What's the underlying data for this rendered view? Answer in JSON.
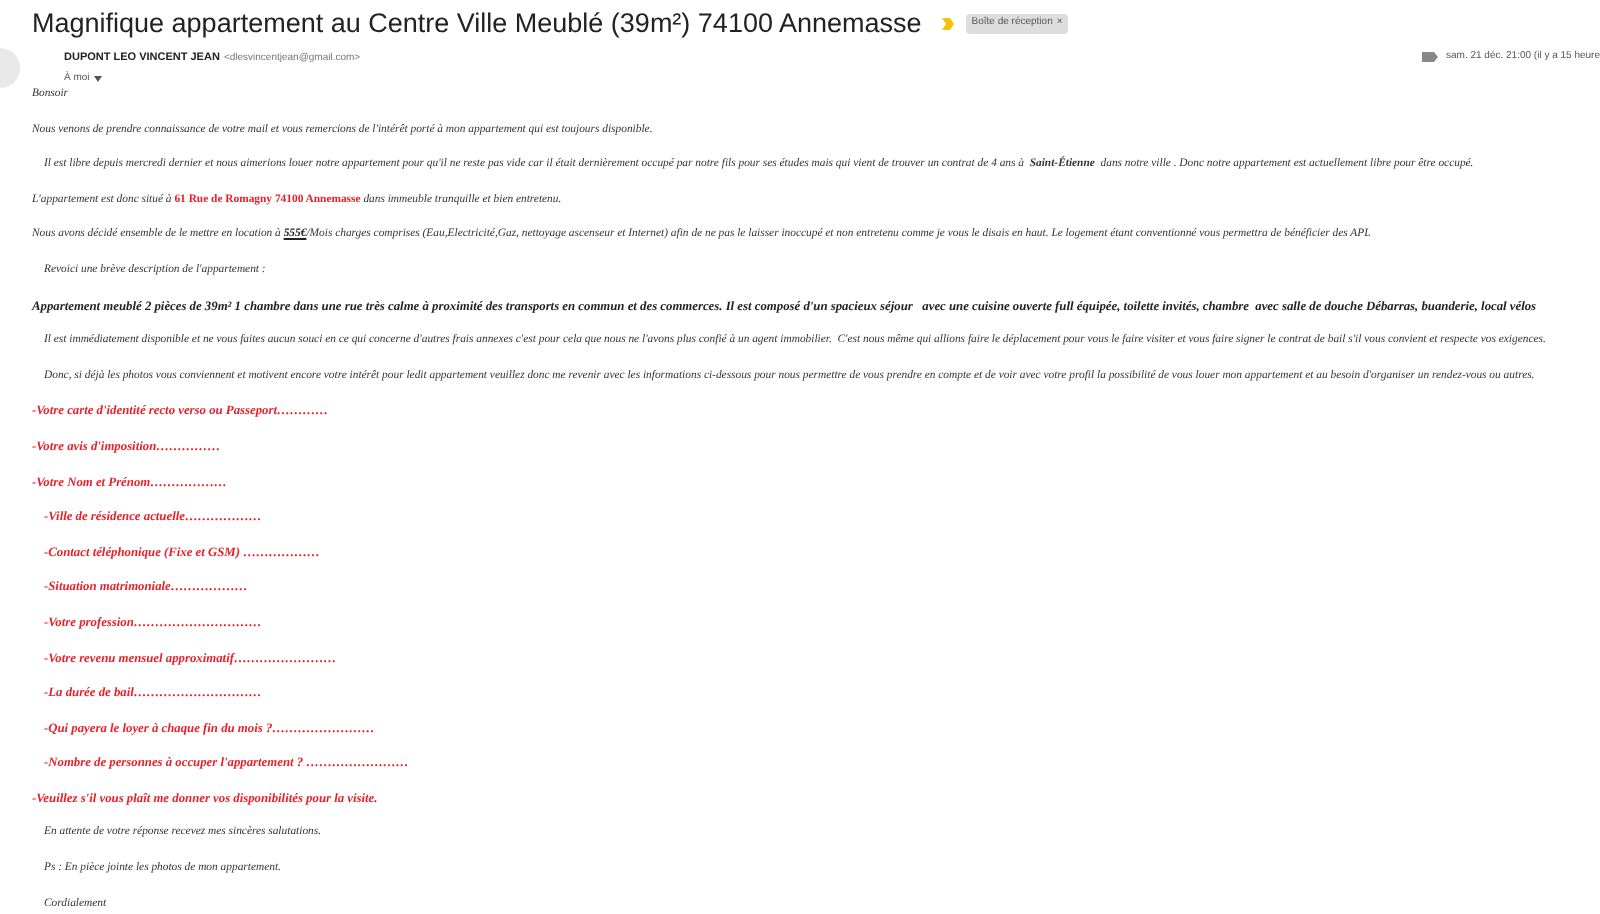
{
  "subject": "Magnifique appartement au Centre Ville Meublé (39m²) 74100 Annemasse",
  "important": true,
  "label": {
    "text": "Boîte de réception",
    "close": "×"
  },
  "sender": {
    "name": "DUPONT LEO VINCENT JEAN",
    "email": "<dlesvincentjean@gmail.com>",
    "to": "À moi"
  },
  "date": "sam. 21 déc. 21:00 (il y a 15 heure",
  "body": [
    {
      "kind": "text",
      "text": "Bonsoir"
    },
    {
      "kind": "text",
      "text": "Nous venons de prendre connaissance de votre mail et vous remercions de l'intérêt porté à mon appartement qui est toujours disponible."
    },
    {
      "kind": "text_indented",
      "text": "Il est libre depuis mercredi dernier et nous aimerions louer notre appartement pour qu'il ne reste pas vide car il était dernièrement occupé par notre fils pour ses études mais qui vient de trouver un contrat de 4 ans à  **Saint-Étienne**  dans notre ville . Donc notre appartement est actuellement libre pour être occupé."
    },
    {
      "kind": "text",
      "parts": [
        {
          "kind": "plain",
          "text": "L'appartement est donc situé à "
        },
        {
          "kind": "red",
          "text": "61 Rue de Romagny 74100 Annemasse"
        },
        {
          "kind": "plain",
          "text": " dans immeuble tranquille et bien entretenu."
        }
      ]
    },
    {
      "kind": "text",
      "parts": [
        {
          "kind": "plain",
          "text": "Nous avons décidé ensemble de le mettre en location à "
        },
        {
          "kind": "underline",
          "text": "555€"
        },
        {
          "kind": "plain",
          "text": "/Mois charges comprises (Eau,Electricité,Gaz, nettoyage ascenseur et Internet) afin de ne pas le laisser inoccupé et non entretenu comme je vous le disais en haut. Le logement étant conventionné vous permettra de bénéficier des APL"
        }
      ]
    },
    {
      "kind": "text_indented",
      "text": "Revoici une brève description de l'appartement :"
    },
    {
      "kind": "bold",
      "text": "Appartement meublé 2 pièces de 39m² 1 chambre dans une rue très calme à proximité des transports en commun et des commerces. Il est composé d'un spacieux séjour   avec une cuisine ouverte full équipée, toilette invités, chambre  avec salle de douche Débarras, buanderie, local vélos"
    },
    {
      "kind": "text_indented",
      "text": "Il est immédiatement disponible et ne vous faites aucun souci en ce qui concerne d'autres frais annexes c'est pour cela que nous ne l'avons plus confié à un agent immobilier.  C'est nous même qui allions faire le déplacement pour vous le faire visiter et vous faire signer le contrat de bail s'il vous convient et respecte vos exigences."
    },
    {
      "kind": "text_indented",
      "text": "Donc, si déjà les photos vous conviennent et motivent encore votre intérêt pour ledit appartement veuillez donc me revenir avec les informations ci-dessous pour nous permettre de vous prendre en compte et de voir avec votre profil la possibilité de vous louer mon appartement et au besoin d'organiser un rendez-vous ou autres."
    },
    {
      "kind": "red",
      "text": "-Votre carte d'identité recto verso ou Passeport…………"
    },
    {
      "kind": "red",
      "text": "-Votre avis d'imposition……………"
    },
    {
      "kind": "red",
      "text": "-Votre Nom et Prénom………………"
    },
    {
      "kind": "red_indented",
      "text": "-Ville de résidence actuelle………………"
    },
    {
      "kind": "red_indented",
      "text": "-Contact téléphonique (Fixe et GSM) ………………"
    },
    {
      "kind": "red_indented",
      "text": "-Situation matrimoniale………………"
    },
    {
      "kind": "red_indented",
      "text": "-Votre profession…………………………"
    },
    {
      "kind": "red_indented",
      "text": "-Votre revenu mensuel approximatif……………………"
    },
    {
      "kind": "red_indented",
      "text": "-La durée de bail…………………………"
    },
    {
      "kind": "red_indented",
      "text": "-Qui payera le loyer à chaque fin du mois ?……………………"
    },
    {
      "kind": "red_indented",
      "text": "-Nombre de personnes à occuper l'appartement ? ……………………"
    },
    {
      "kind": "red",
      "text": "-Veuillez s'il vous plaît me donner vos disponibilités pour la visite."
    },
    {
      "kind": "text_indented",
      "text": "En attente de votre réponse recevez mes sincères salutations."
    },
    {
      "kind": "text_indented",
      "text": "Ps : En pièce jointe les photos de mon appartement."
    },
    {
      "kind": "text_indented",
      "text": "Cordialement"
    }
  ]
}
